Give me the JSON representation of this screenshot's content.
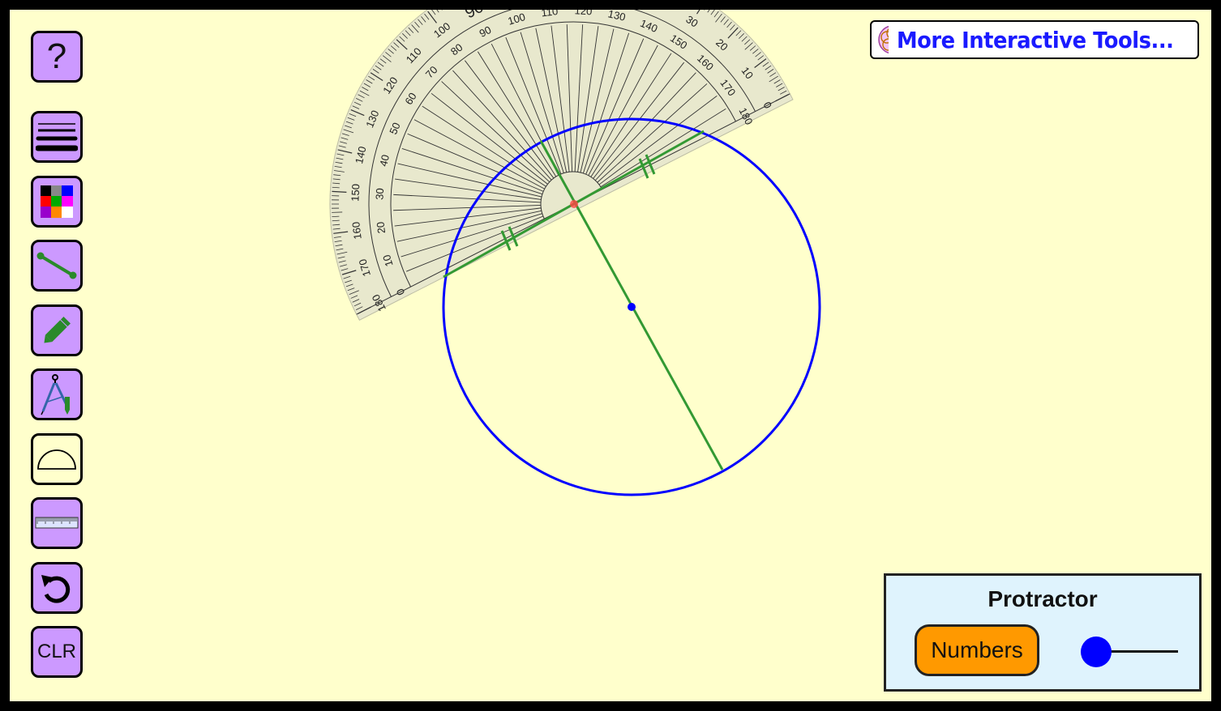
{
  "toolbar": {
    "help_label": "?",
    "clear_label": "CLR",
    "items": [
      "help",
      "line-thickness",
      "color-palette",
      "line-segment",
      "pencil",
      "compass",
      "protractor",
      "ruler",
      "undo",
      "clear"
    ],
    "active_tool": "protractor"
  },
  "header": {
    "more_tools_label": "More Interactive Tools..."
  },
  "protractor_panel": {
    "title": "Protractor",
    "numbers_button_label": "Numbers",
    "size_slider_level": 0
  },
  "protractor": {
    "outer_scale_labels": [
      "0",
      "10",
      "20",
      "30",
      "40",
      "50",
      "60",
      "70",
      "80",
      "90",
      "100",
      "110",
      "120",
      "130",
      "140",
      "150",
      "160",
      "170",
      "180"
    ],
    "inner_scale_labels": [
      "180",
      "170",
      "160",
      "150",
      "140",
      "130",
      "120",
      "110",
      "100",
      "90",
      "80",
      "70",
      "60",
      "50",
      "40",
      "30",
      "20",
      "10",
      "0"
    ]
  },
  "colors": {
    "background": "#ffffcc",
    "tool_button": "#cc99ff",
    "circle": "#0000ff",
    "chord": "#339933",
    "numbers_button": "#ff9900",
    "panel": "#dff3fd",
    "link_text": "#1a1aff"
  },
  "icons": [
    "question-icon",
    "lines-icon",
    "palette-icon",
    "segment-icon",
    "pencil-icon",
    "compass-icon",
    "semicircle-icon",
    "ruler-icon",
    "undo-icon",
    "flower-logo-icon"
  ]
}
